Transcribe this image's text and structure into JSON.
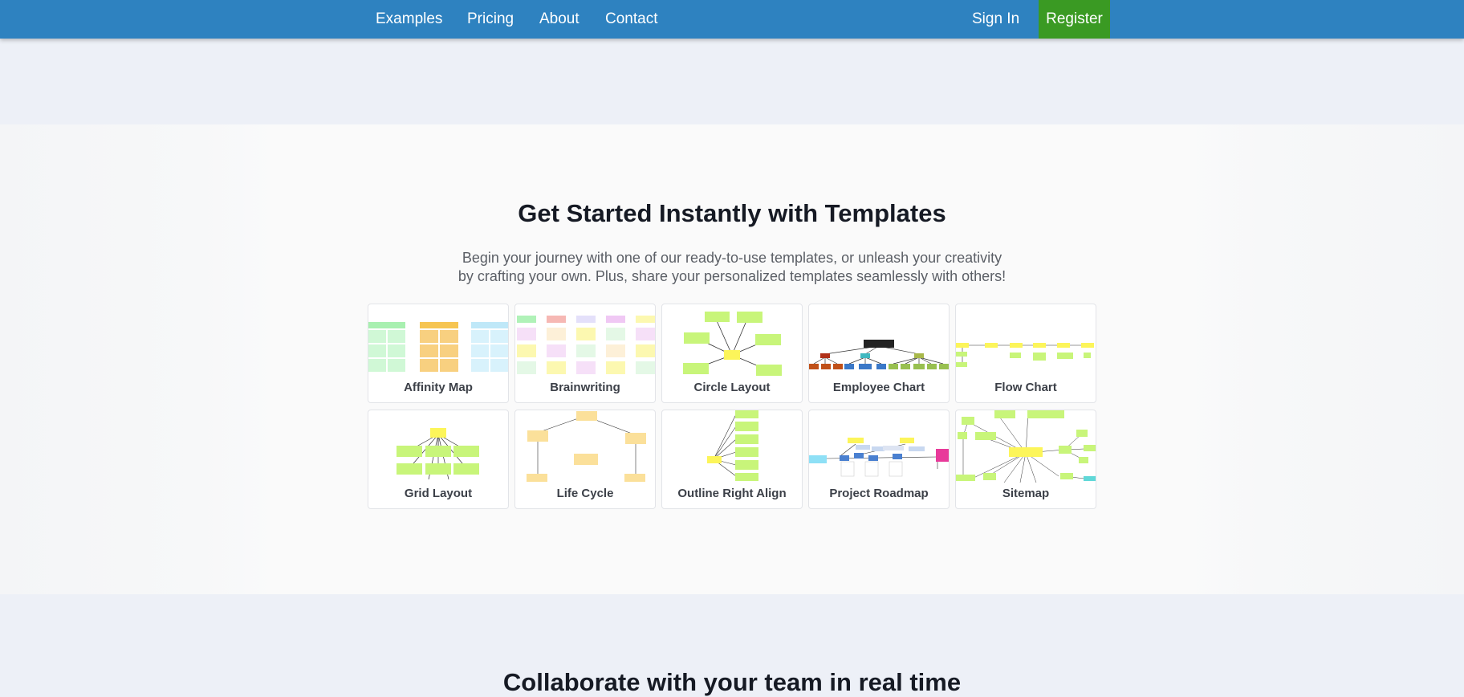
{
  "nav": {
    "links": [
      "Examples",
      "Pricing",
      "About",
      "Contact"
    ],
    "sign_in": "Sign In",
    "register": "Register"
  },
  "templates_section": {
    "title": "Get Started Instantly with Templates",
    "subtitle_line1": "Begin your journey with one of our ready-to-use templates, or unleash your creativity",
    "subtitle_line2": "by crafting your own. Plus, share your personalized templates seamlessly with others!",
    "cards": [
      {
        "label": "Affinity Map"
      },
      {
        "label": "Brainwriting"
      },
      {
        "label": "Circle Layout"
      },
      {
        "label": "Employee Chart"
      },
      {
        "label": "Flow Chart"
      },
      {
        "label": "Grid Layout"
      },
      {
        "label": "Life Cycle"
      },
      {
        "label": "Outline Right Align"
      },
      {
        "label": "Project Roadmap"
      },
      {
        "label": "Sitemap"
      }
    ]
  },
  "collaborate_section": {
    "title": "Collaborate with your team in real time"
  },
  "colors": {
    "nav_background": "#2e82c0",
    "register_background": "#3a9a23",
    "page_background": "#edf0f7"
  }
}
